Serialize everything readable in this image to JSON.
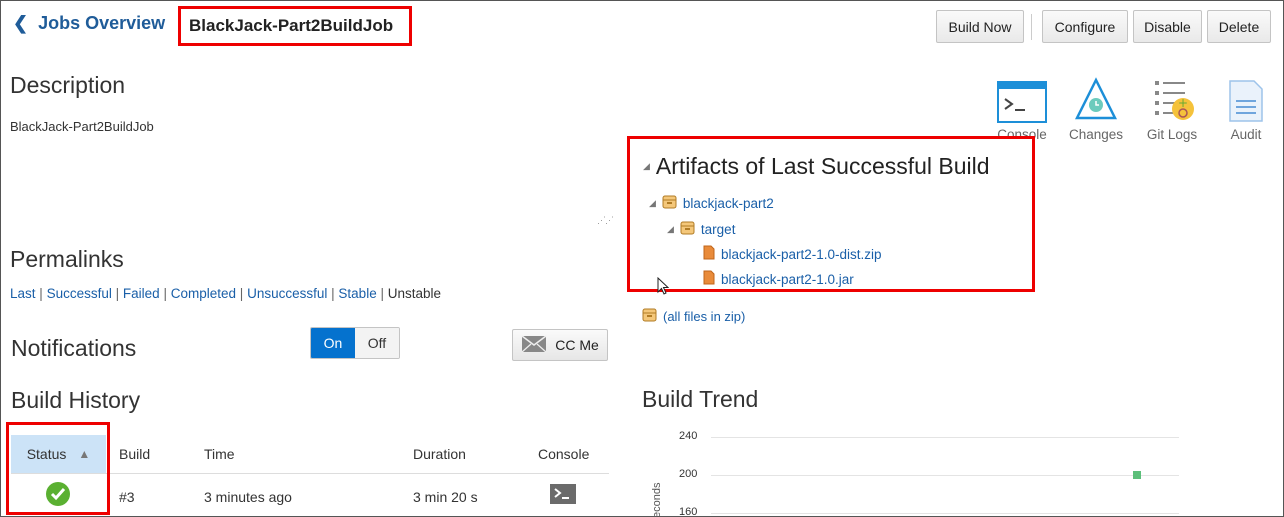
{
  "header": {
    "back_label": "Jobs Overview",
    "job_name": "BlackJack-Part2BuildJob",
    "buttons": {
      "build_now": "Build Now",
      "configure": "Configure",
      "disable": "Disable",
      "delete": "Delete"
    }
  },
  "description": {
    "title": "Description",
    "text": "BlackJack-Part2BuildJob"
  },
  "tools": [
    {
      "label": "Console",
      "icon": "console-icon"
    },
    {
      "label": "Changes",
      "icon": "changes-icon"
    },
    {
      "label": "Git Logs",
      "icon": "git-logs-icon"
    },
    {
      "label": "Audit",
      "icon": "audit-icon"
    }
  ],
  "permalinks": {
    "title": "Permalinks",
    "links": [
      "Last",
      "Successful",
      "Failed",
      "Completed",
      "Unsuccessful",
      "Stable"
    ],
    "plain": "Unstable",
    "separator": "|"
  },
  "notifications": {
    "title": "Notifications",
    "on": "On",
    "off": "Off",
    "cc_me": "CC Me"
  },
  "build_history": {
    "title": "Build History",
    "columns": [
      "Status",
      "Build",
      "Time",
      "Duration",
      "Console"
    ],
    "rows": [
      {
        "status": "success",
        "build": "#3",
        "time": "3 minutes ago",
        "duration": "3 min 20 s"
      }
    ]
  },
  "artifacts": {
    "title": "Artifacts of Last Successful Build",
    "root": "blackjack-part2",
    "folder": "target",
    "files": [
      "blackjack-part2-1.0-dist.zip",
      "blackjack-part2-1.0.jar"
    ],
    "all_files": "(all files in zip)"
  },
  "build_trend": {
    "title": "Build Trend",
    "ylabel": "econds"
  },
  "chart_data": {
    "type": "scatter",
    "title": "Build Trend",
    "ylabel": "econds",
    "y_ticks": [
      "240",
      "200",
      "160"
    ],
    "ylim": [
      160,
      240
    ],
    "points": [
      {
        "x": "#3",
        "y": 200
      }
    ],
    "point_color": "#5cbf7a"
  },
  "colors": {
    "accent": "#0572ce",
    "highlight": "#e00000",
    "success": "#5ab031"
  }
}
